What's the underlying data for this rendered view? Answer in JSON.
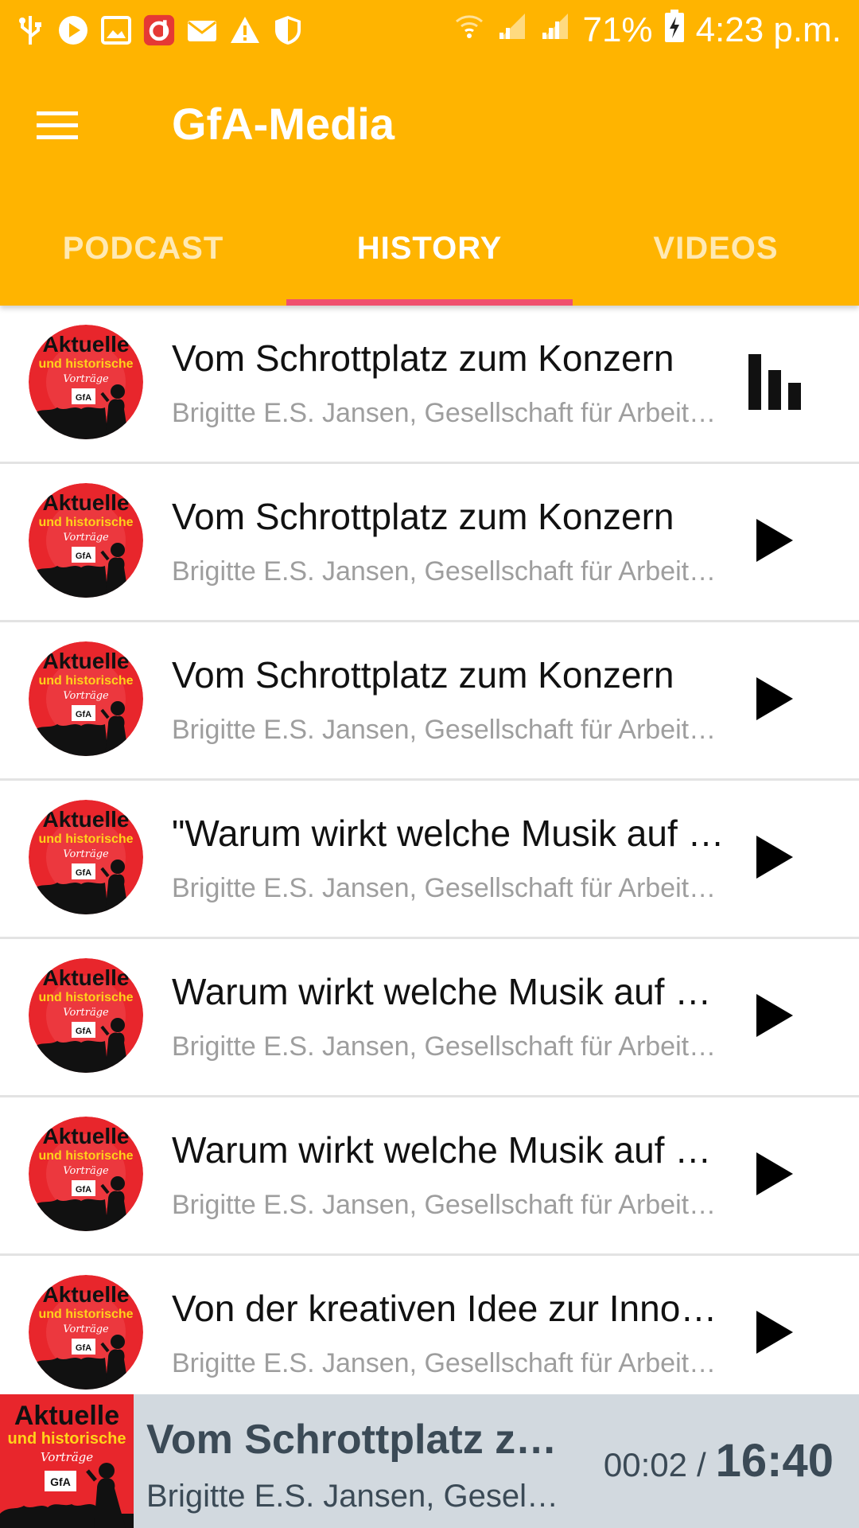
{
  "status_bar": {
    "battery": "71%",
    "time": "4:23 p.m.",
    "left_icons": [
      "usb-icon",
      "play-store-icon",
      "image-icon",
      "app-notification-icon",
      "mail-icon",
      "warning-icon",
      "shield-icon"
    ],
    "right_icons": [
      "wifi-icon",
      "signal-icon",
      "signal-icon",
      "battery-charging-icon"
    ]
  },
  "app": {
    "title": "GfA-Media",
    "accent_color": "#FFB400",
    "indicator_color": "#F0506E"
  },
  "tabs": [
    {
      "label": "PODCAST",
      "active": false
    },
    {
      "label": "HISTORY",
      "active": true
    },
    {
      "label": "VIDEOS",
      "active": false
    }
  ],
  "artwork": {
    "line1": "Aktuelle",
    "line2": "und historische",
    "line3": "Vorträge",
    "badge": "GfA"
  },
  "history": [
    {
      "title": "Vom Schrottplatz zum Konzern",
      "subtitle": "Brigitte E.S. Jansen, Gesellschaft für Arbeitsmedizin",
      "action": "equalizer-icon"
    },
    {
      "title": "Vom Schrottplatz zum Konzern",
      "subtitle": "Brigitte E.S. Jansen, Gesellschaft für Arbeitsmedizin",
      "action": "play-icon"
    },
    {
      "title": "Vom Schrottplatz zum Konzern",
      "subtitle": "Brigitte E.S. Jansen, Gesellschaft für Arbeitsmedizin",
      "action": "play-icon"
    },
    {
      "title": "\"Warum wirkt welche Musik auf uns?\"",
      "subtitle": "Brigitte E.S. Jansen, Gesellschaft für Arbeitsmedizin",
      "action": "play-icon"
    },
    {
      "title": "Warum wirkt welche Musik auf uns?",
      "subtitle": "Brigitte E.S. Jansen, Gesellschaft für Arbeitsmedizin",
      "action": "play-icon"
    },
    {
      "title": "Warum wirkt welche Musik auf uns?",
      "subtitle": "Brigitte E.S. Jansen, Gesellschaft für Arbeitsmedizin",
      "action": "play-icon"
    },
    {
      "title": "Von der kreativen Idee zur Innovation",
      "subtitle": "Brigitte E.S. Jansen, Gesellschaft für Arbeitsmedizin",
      "action": "play-icon"
    }
  ],
  "player": {
    "title": "Vom Schrottplatz zum Konzern",
    "subtitle": "Brigitte E.S. Jansen, Gesellschaft für Arbeitsmedizin",
    "current_time": "00:02",
    "separator": "/",
    "total_time": "16:40",
    "background": "#D2D9DF"
  }
}
